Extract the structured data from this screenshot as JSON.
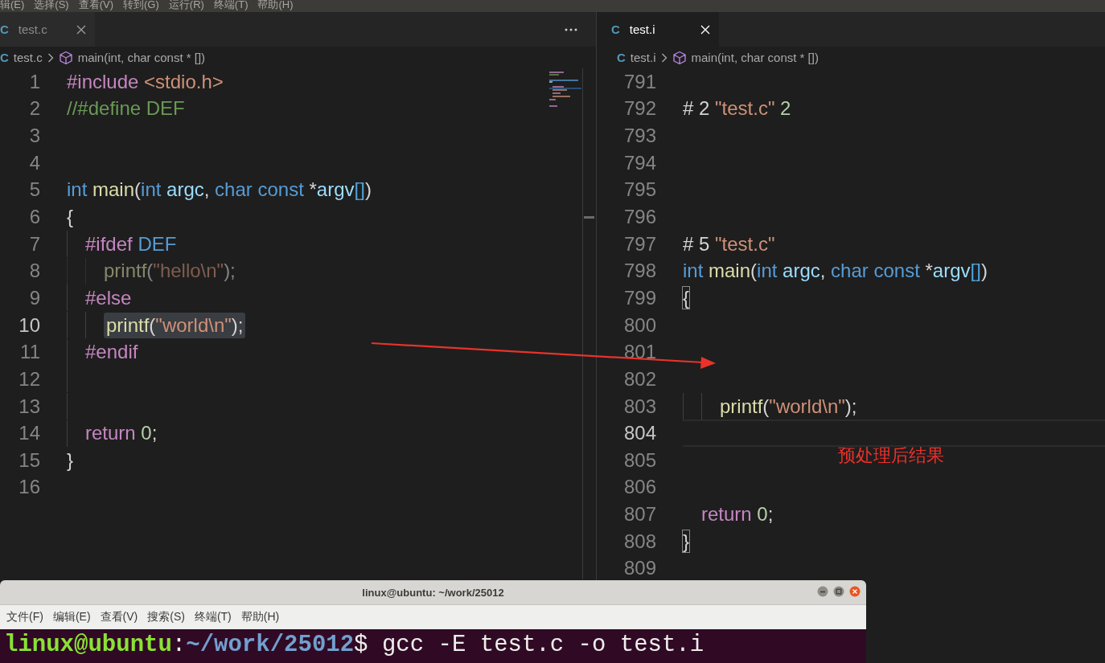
{
  "menu_bar": {
    "items": [
      "辑(E)",
      "选择(S)",
      "查看(V)",
      "转到(G)",
      "运行(R)",
      "终端(T)",
      "帮助(H)"
    ]
  },
  "editors": [
    {
      "tab": {
        "file_icon": "C",
        "label": "test.c",
        "selected": false
      },
      "more_actions": true,
      "breadcrumb": {
        "file_icon": "C",
        "file": "test.c",
        "symbol": "main(int, char const * [])"
      },
      "minimap": true,
      "lines": [
        {
          "number": "1",
          "current": false,
          "tokens": [
            {
              "kind": "directive",
              "text": "#include"
            },
            {
              "kind": "string",
              "text": " <stdio.h>"
            }
          ]
        },
        {
          "number": "2",
          "current": false,
          "tokens": [
            {
              "kind": "comment",
              "text": "//#define DEF"
            }
          ]
        },
        {
          "number": "3",
          "current": false
        },
        {
          "number": "4",
          "current": false
        },
        {
          "number": "5",
          "current": false,
          "tokens": [
            {
              "kind": "keyword",
              "text": "int"
            },
            {
              "kind": "function",
              "text": " main"
            },
            {
              "kind": "plain",
              "text": "("
            },
            {
              "kind": "keyword",
              "text": "int"
            },
            {
              "kind": "variable",
              "text": " argc"
            },
            {
              "kind": "plain",
              "text": ", "
            },
            {
              "kind": "keyword",
              "text": "char const"
            },
            {
              "kind": "plain",
              "text": " *"
            },
            {
              "kind": "variable",
              "text": "argv"
            },
            {
              "kind": "bracket",
              "text": "[]"
            },
            {
              "kind": "plain",
              "text": ")"
            }
          ]
        },
        {
          "number": "6",
          "current": false,
          "tokens": [
            {
              "kind": "plain",
              "text": "{"
            }
          ]
        },
        {
          "number": "7",
          "current": false,
          "tokens": [
            {
              "kind": "indent"
            },
            {
              "kind": "directive",
              "text": "#ifdef"
            },
            {
              "kind": "macro",
              "text": " DEF"
            }
          ]
        },
        {
          "number": "8",
          "current": false,
          "inactive": true,
          "tokens": [
            {
              "kind": "indent"
            },
            {
              "kind": "indent"
            },
            {
              "kind": "function",
              "text": "printf"
            },
            {
              "kind": "plain",
              "text": "("
            },
            {
              "kind": "string",
              "text": "\"hello\\n\""
            },
            {
              "kind": "plain",
              "text": ");"
            }
          ]
        },
        {
          "number": "9",
          "current": false,
          "tokens": [
            {
              "kind": "indent"
            },
            {
              "kind": "directive",
              "text": "#else"
            }
          ]
        },
        {
          "number": "10",
          "current": true,
          "selection": true,
          "tokens": [
            {
              "kind": "indent"
            },
            {
              "kind": "indent"
            },
            {
              "kind": "function",
              "text": "printf"
            },
            {
              "kind": "plain",
              "text": "("
            },
            {
              "kind": "string",
              "text": "\"world\\n\""
            },
            {
              "kind": "plain",
              "text": ");"
            }
          ]
        },
        {
          "number": "11",
          "current": false,
          "tokens": [
            {
              "kind": "indent"
            },
            {
              "kind": "directive",
              "text": "#endif"
            }
          ]
        },
        {
          "number": "12",
          "current": false,
          "tokens": [
            {
              "kind": "indent"
            }
          ]
        },
        {
          "number": "13",
          "current": false,
          "tokens": [
            {
              "kind": "indent"
            }
          ]
        },
        {
          "number": "14",
          "current": false,
          "tokens": [
            {
              "kind": "indent"
            },
            {
              "kind": "control",
              "text": "return"
            },
            {
              "kind": "number",
              "text": " 0"
            },
            {
              "kind": "plain",
              "text": ";"
            }
          ]
        },
        {
          "number": "15",
          "current": false,
          "tokens": [
            {
              "kind": "plain",
              "text": "}"
            }
          ]
        },
        {
          "number": "16",
          "current": false
        }
      ]
    },
    {
      "tab": {
        "file_icon": "C",
        "label": "test.i",
        "selected": true
      },
      "breadcrumb": {
        "file_icon": "C",
        "file": "test.i",
        "symbol": "main(int, char const * [])"
      },
      "lines": [
        {
          "number": "791",
          "current": false
        },
        {
          "number": "792",
          "current": false,
          "tokens": [
            {
              "kind": "plain",
              "text": "# 2 "
            },
            {
              "kind": "string",
              "text": "\"test.c\""
            },
            {
              "kind": "number",
              "text": " 2"
            }
          ]
        },
        {
          "number": "793",
          "current": false
        },
        {
          "number": "794",
          "current": false
        },
        {
          "number": "795",
          "current": false
        },
        {
          "number": "796",
          "current": false
        },
        {
          "number": "797",
          "current": false,
          "tokens": [
            {
              "kind": "plain",
              "text": "# 5 "
            },
            {
              "kind": "string",
              "text": "\"test.c\""
            }
          ]
        },
        {
          "number": "798",
          "current": false,
          "tokens": [
            {
              "kind": "keyword",
              "text": "int"
            },
            {
              "kind": "function",
              "text": " main"
            },
            {
              "kind": "plain",
              "text": "("
            },
            {
              "kind": "keyword",
              "text": "int"
            },
            {
              "kind": "variable",
              "text": " argc"
            },
            {
              "kind": "plain",
              "text": ", "
            },
            {
              "kind": "keyword",
              "text": "char const"
            },
            {
              "kind": "plain",
              "text": " *"
            },
            {
              "kind": "variable",
              "text": "argv"
            },
            {
              "kind": "bracket",
              "text": "[]"
            },
            {
              "kind": "plain",
              "text": ")"
            }
          ]
        },
        {
          "number": "799",
          "current": false,
          "tokens": [
            {
              "kind": "bracket-match",
              "text": "{"
            }
          ]
        },
        {
          "number": "800",
          "current": false
        },
        {
          "number": "801",
          "current": false
        },
        {
          "number": "802",
          "current": false
        },
        {
          "number": "803",
          "current": false,
          "tokens": [
            {
              "kind": "indent"
            },
            {
              "kind": "indent"
            },
            {
              "kind": "function",
              "text": "printf"
            },
            {
              "kind": "plain",
              "text": "("
            },
            {
              "kind": "string",
              "text": "\"world\\n\""
            },
            {
              "kind": "plain",
              "text": ");"
            }
          ]
        },
        {
          "number": "804",
          "current": true
        },
        {
          "number": "805",
          "current": false
        },
        {
          "number": "806",
          "current": false
        },
        {
          "number": "807",
          "current": false,
          "tokens": [
            {
              "kind": "space"
            },
            {
              "kind": "control",
              "text": "return"
            },
            {
              "kind": "number",
              "text": " 0"
            },
            {
              "kind": "plain",
              "text": ";"
            }
          ]
        },
        {
          "number": "808",
          "current": false,
          "tokens": [
            {
              "kind": "bracket-match",
              "text": "}"
            }
          ]
        },
        {
          "number": "809",
          "current": false
        }
      ]
    }
  ],
  "annotation": {
    "text": "预处理后结果"
  },
  "terminal": {
    "title": "linux@ubuntu: ~/work/25012",
    "menu": [
      "文件(F)",
      "编辑(E)",
      "查看(V)",
      "搜索(S)",
      "终端(T)",
      "帮助(H)"
    ],
    "prompt": {
      "user_host": "linux@ubuntu",
      "separator": ":",
      "path": "~/work/25012",
      "symbol": "$",
      "command": " gcc -E test.c -o test.i"
    }
  }
}
